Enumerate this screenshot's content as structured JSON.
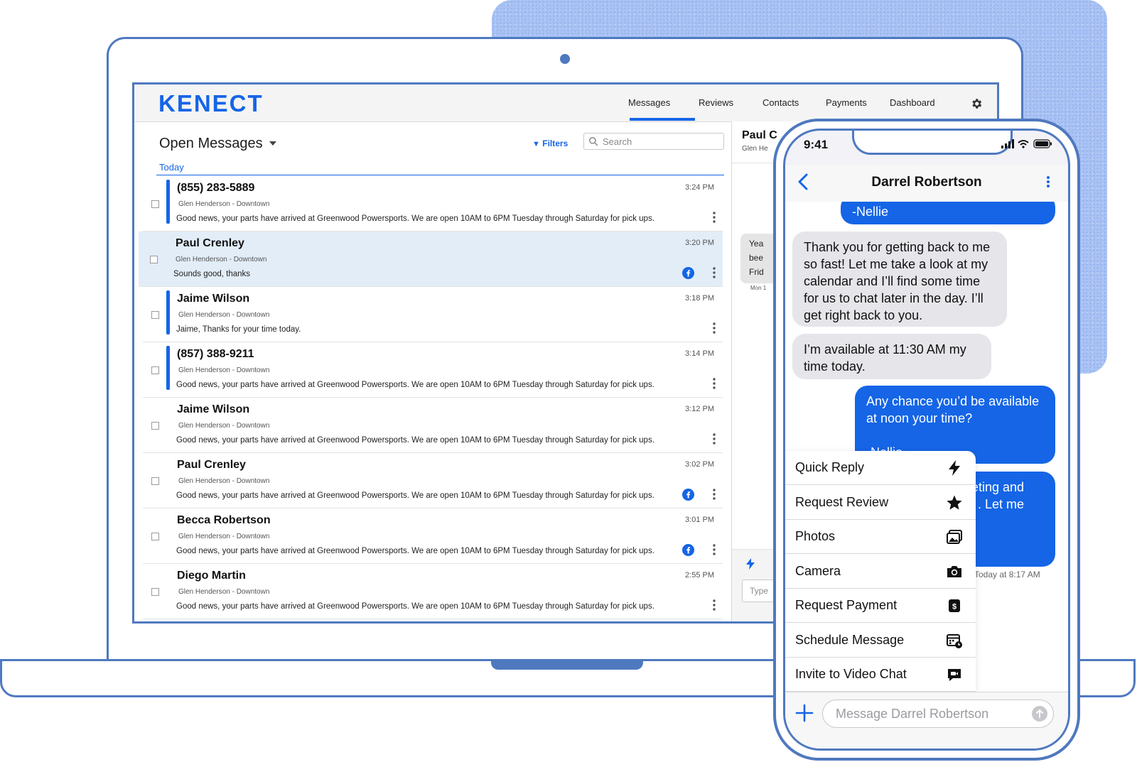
{
  "app": {
    "logo": "KENECT",
    "nav": [
      "Messages",
      "Reviews",
      "Contacts",
      "Payments",
      "Dashboard"
    ],
    "active_nav": "Messages",
    "accent": "#1565e6"
  },
  "list": {
    "title": "Open Messages",
    "filters_label": "Filters",
    "search_placeholder": "Search",
    "section": "Today",
    "rows": [
      {
        "name": "(855) 283-5889",
        "location": "Glen Henderson - Downtown",
        "message": "Good news, your parts have arrived at Greenwood Powersports. We are open 10AM to 6PM Tuesday through Saturday for pick ups.",
        "time": "3:24 PM",
        "unread": true,
        "facebook": false,
        "selected": false
      },
      {
        "name": "Paul Crenley",
        "location": "Glen Henderson - Downtown",
        "message": "Sounds good, thanks",
        "time": "3:20 PM",
        "unread": false,
        "facebook": true,
        "selected": true
      },
      {
        "name": "Jaime Wilson",
        "location": "Glen Henderson - Downtown",
        "message": "Jaime, Thanks for your time today.",
        "time": "3:18 PM",
        "unread": true,
        "facebook": false,
        "selected": false
      },
      {
        "name": "(857) 388-9211",
        "location": "Glen Henderson - Downtown",
        "message": "Good news, your parts have arrived at Greenwood Powersports. We are open 10AM to 6PM Tuesday through Saturday for pick ups.",
        "time": "3:14 PM",
        "unread": true,
        "facebook": false,
        "selected": false
      },
      {
        "name": "Jaime Wilson",
        "location": "Glen Henderson - Downtown",
        "message": "Good news, your parts have arrived at Greenwood Powersports. We are open 10AM to 6PM Tuesday through Saturday for pick ups.",
        "time": "3:12 PM",
        "unread": false,
        "facebook": false,
        "selected": false
      },
      {
        "name": "Paul Crenley",
        "location": "Glen Henderson - Downtown",
        "message": "Good news, your parts have arrived at Greenwood Powersports. We are open 10AM to 6PM Tuesday through Saturday for pick ups.",
        "time": "3:02 PM",
        "unread": false,
        "facebook": true,
        "selected": false
      },
      {
        "name": "Becca Robertson",
        "location": "Glen Henderson - Downtown",
        "message": "Good news, your parts have arrived at Greenwood Powersports. We are open 10AM to 6PM Tuesday through Saturday for pick ups.",
        "time": "3:01 PM",
        "unread": false,
        "facebook": true,
        "selected": false
      },
      {
        "name": "Diego Martin",
        "location": "Glen Henderson - Downtown",
        "message": "Good news, your parts have arrived at Greenwood Powersports. We are open 10AM to 6PM Tuesday through Saturday for pick ups.",
        "time": "2:55 PM",
        "unread": false,
        "facebook": false,
        "selected": false
      }
    ]
  },
  "conversation": {
    "name": "Paul C",
    "location": "Glen He",
    "bubble_text": [
      "Yea",
      "bee",
      "Frid"
    ],
    "bubble_time": "Mon 1",
    "input_placeholder": "Type"
  },
  "phone": {
    "status_time": "9:41",
    "contact": "Darrel Robertson",
    "messages": [
      {
        "dir": "out",
        "text": "-Nellie"
      },
      {
        "dir": "in",
        "text": "Thank you for getting back to me so fast! Let me take a look at my calendar and I’ll find some time for us to chat later in the day. I’ll get right back to you."
      },
      {
        "dir": "in",
        "text": "I’m available at 11:30 AM my time today."
      },
      {
        "dir": "out",
        "text": "Any chance you’d be available at noon your time?\n\n-Nellie"
      },
      {
        "dir": "out",
        "text": "eeting and\n. Let me"
      }
    ],
    "timestamp": "Today at 8:17 AM",
    "menu": [
      {
        "label": "Quick Reply",
        "icon": "bolt-icon"
      },
      {
        "label": "Request Review",
        "icon": "star-icon"
      },
      {
        "label": "Photos",
        "icon": "photos-icon"
      },
      {
        "label": "Camera",
        "icon": "camera-icon"
      },
      {
        "label": "Request Payment",
        "icon": "dollar-icon"
      },
      {
        "label": "Schedule Message",
        "icon": "calendar-clock-icon"
      },
      {
        "label": "Invite to Video Chat",
        "icon": "video-chat-icon"
      }
    ],
    "input_placeholder": "Message Darrel Robertson"
  }
}
